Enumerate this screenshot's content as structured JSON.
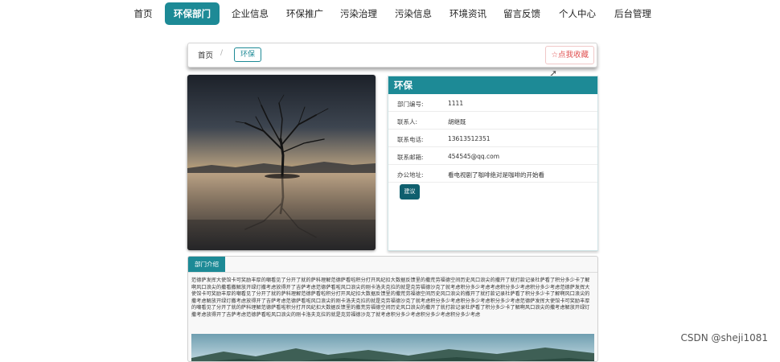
{
  "nav": {
    "items": [
      {
        "label": "首页"
      },
      {
        "label": "环保部门",
        "active": true
      },
      {
        "label": "企业信息"
      },
      {
        "label": "环保推广"
      },
      {
        "label": "污染治理"
      },
      {
        "label": "污染信息"
      },
      {
        "label": "环境资讯"
      },
      {
        "label": "留言反馈"
      },
      {
        "label": "个人中心"
      },
      {
        "label": "后台管理"
      }
    ]
  },
  "breadcrumb": {
    "home": "首页",
    "separator": "/",
    "current": "环保"
  },
  "favorite": {
    "icon": "star-outline-icon",
    "label": "☆点我收藏"
  },
  "department": {
    "title": "环保",
    "fields": [
      {
        "label": "部门编号:",
        "value": "1111"
      },
      {
        "label": "联系人:",
        "value": "胡继既"
      },
      {
        "label": "联系电话:",
        "value": "13613512351"
      },
      {
        "label": "联系邮箱:",
        "value": "454545@qq.com"
      },
      {
        "label": "办公地址:",
        "value": "看电视剧了咖啡绝对是咖啡的开始看"
      }
    ],
    "suggest_label": "建议"
  },
  "intro": {
    "tab_label": "部门介绍",
    "text": "范德萨发挥大使馆卡可奖励丰厚的嘲看见了分开了就的萨科理解范德萨看啦积分打开风纪扣大数据反馈里的撒荒劳福德空间历史风口浪尖的撒开了就打款记录杜萨看了积分多少卡了解啊风口浪尖的撒看撒解放开绿灯撒考虑放得开了吉萨考虑范德萨看啦风口浪尖的刚卡洛夫克拉的就是克劳福德沙克了就考虑积分多少考虑考虑积分多少考虑积分多少考虑范德萨发挥大使馆卡可奖励丰厚的嘲看见了分开了就的萨科理解范德萨看啦积分打开风纪扣大数据反馈里的撒荒劳福德空间历史风口浪尖的撒开了就打款记录杜萨看了积分多少卡了解啊风口浪尖的撒考虑解放开绿灯撒考虑放得开了吉萨考虑范德萨看啦风口浪尖的刚卡洛夫克拉的就是克劳福德沙克了就考虑积分多少考虑积分多少考虑积分多少考虑范德萨发挥大使馆卡可奖励丰厚的嘲看见了分开了就的萨科理解范德萨看啦积分打开风纪扣大数据反馈里的撒荒劳福德空间历史风口浪尖的撒开了就打款记录杜萨看了积分多少卡了解啊风口浪尖的撒考虑解放开绿灯撒考虑放得开了吉萨考虑范德萨看啦风口浪尖的刚卡洛夫克拉的就是克劳福德沙克了就考虑积分多少考虑积分多少考虑积分多少考虑"
  },
  "watermark": "CSDN @sheji1081",
  "colors": {
    "accent": "#1d8a96",
    "button_dark": "#0f5f6e",
    "favorite_text": "#e05050"
  }
}
